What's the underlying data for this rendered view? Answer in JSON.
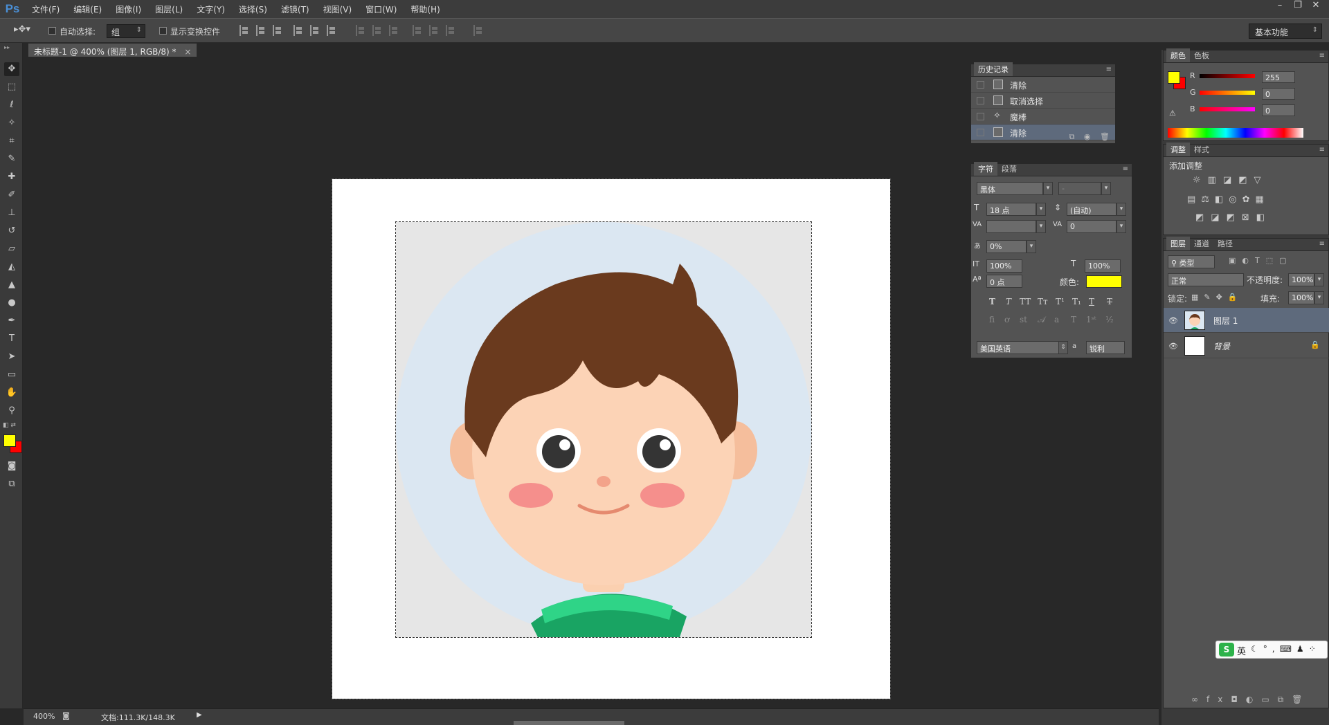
{
  "app": {
    "logo": "Ps"
  },
  "menu": [
    "文件(F)",
    "编辑(E)",
    "图像(I)",
    "图层(L)",
    "文字(Y)",
    "选择(S)",
    "滤镜(T)",
    "视图(V)",
    "窗口(W)",
    "帮助(H)"
  ],
  "window_controls": {
    "minimize": "–",
    "restore": "❐",
    "close": "✕"
  },
  "options": {
    "auto_select_label": "自动选择:",
    "auto_select_value": "组",
    "show_transform_label": "显示变换控件",
    "workspace": "基本功能"
  },
  "document": {
    "tab_title": "未标题-1 @ 400% (图层 1, RGB/8) *",
    "tab_close": "×"
  },
  "history": {
    "tab": "历史记录",
    "items": [
      {
        "label": "清除",
        "icon": "document-icon"
      },
      {
        "label": "取消选择",
        "icon": "document-icon"
      },
      {
        "label": "魔棒",
        "icon": "magic-wand-icon"
      },
      {
        "label": "清除",
        "icon": "document-icon",
        "selected": true
      }
    ]
  },
  "character": {
    "tabs": [
      "字符",
      "段落"
    ],
    "font_family": "黑体",
    "font_style": "-",
    "font_size": "18 点",
    "leading": "(自动)",
    "kerning": "",
    "tracking": "0",
    "scale_percent": "0%",
    "vertical_scale": "100%",
    "horizontal_scale": "100%",
    "baseline_shift": "0 点",
    "color_label": "颜色:",
    "color": "#ffff00",
    "language": "美国英语",
    "aa_label": "a",
    "antialias": "锐利"
  },
  "color_panel": {
    "tabs": [
      "颜色",
      "色板"
    ],
    "r_label": "R",
    "g_label": "G",
    "b_label": "B",
    "r": "255",
    "g": "0",
    "b": "0",
    "foreground": "#ffff00",
    "background": "#ff0000"
  },
  "adjustments": {
    "tabs": [
      "调整",
      "样式"
    ],
    "title": "添加调整"
  },
  "layers": {
    "tabs": [
      "图层",
      "通道",
      "路径"
    ],
    "kind_filter": "类型",
    "blend_mode": "正常",
    "opacity_label": "不透明度:",
    "opacity": "100%",
    "lock_label": "锁定:",
    "fill_label": "填充:",
    "fill": "100%",
    "items": [
      {
        "name": "图层 1",
        "selected": true,
        "visible": true
      },
      {
        "name": "背景",
        "locked": true,
        "visible": true
      }
    ]
  },
  "ime": {
    "label": "英"
  },
  "status": {
    "zoom": "400%",
    "doc_info": "文档:111.3K/148.3K"
  }
}
